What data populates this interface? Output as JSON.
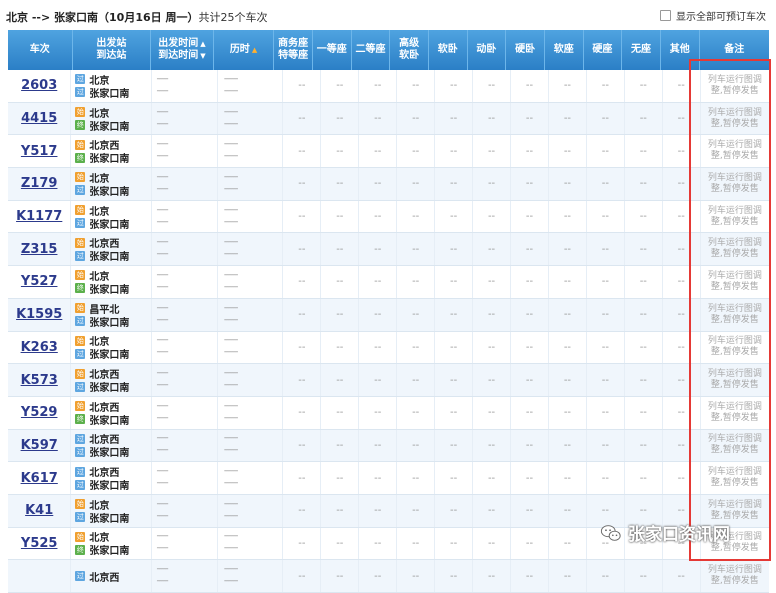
{
  "header": {
    "route": "北京 --> 张家口南（10月16日 周一）",
    "count": "共计25个车次",
    "show_all_label": "显示全部可预订车次"
  },
  "columns": {
    "train": "车次",
    "stations_1": "出发站",
    "stations_2": "到达站",
    "times_1": "出发时间",
    "times_2": "到达时间",
    "duration": "历时",
    "business_1": "商务座",
    "business_2": "特等座",
    "first": "一等座",
    "second": "二等座",
    "premium_1": "高级",
    "premium_2": "软卧",
    "soft_sleeper": "软卧",
    "moving_sleeper": "动卧",
    "hard_sleeper": "硬卧",
    "soft_seat": "软座",
    "hard_seat": "硬座",
    "no_seat": "无座",
    "other": "其他",
    "note": "备注"
  },
  "placeholders": {
    "time": "-----",
    "dur": "------",
    "seat": "--"
  },
  "badges": {
    "pass": "过",
    "start": "始",
    "end": "终"
  },
  "note_text": [
    "列车运行图调",
    "整,暂停发售"
  ],
  "trains": [
    {
      "no": "2603",
      "from": "北京",
      "from_badge": "过",
      "to": "张家口南",
      "to_badge": "过"
    },
    {
      "no": "4415",
      "from": "北京",
      "from_badge": "始",
      "to": "张家口南",
      "to_badge": "终"
    },
    {
      "no": "Y517",
      "from": "北京西",
      "from_badge": "始",
      "to": "张家口南",
      "to_badge": "终"
    },
    {
      "no": "Z179",
      "from": "北京",
      "from_badge": "始",
      "to": "张家口南",
      "to_badge": "过"
    },
    {
      "no": "K1177",
      "from": "北京",
      "from_badge": "始",
      "to": "张家口南",
      "to_badge": "过"
    },
    {
      "no": "Z315",
      "from": "北京西",
      "from_badge": "始",
      "to": "张家口南",
      "to_badge": "过"
    },
    {
      "no": "Y527",
      "from": "北京",
      "from_badge": "始",
      "to": "张家口南",
      "to_badge": "终"
    },
    {
      "no": "K1595",
      "from": "昌平北",
      "from_badge": "始",
      "to": "张家口南",
      "to_badge": "过"
    },
    {
      "no": "K263",
      "from": "北京",
      "from_badge": "始",
      "to": "张家口南",
      "to_badge": "过"
    },
    {
      "no": "K573",
      "from": "北京西",
      "from_badge": "始",
      "to": "张家口南",
      "to_badge": "过"
    },
    {
      "no": "Y529",
      "from": "北京西",
      "from_badge": "始",
      "to": "张家口南",
      "to_badge": "终"
    },
    {
      "no": "K597",
      "from": "北京西",
      "from_badge": "过",
      "to": "张家口南",
      "to_badge": "过"
    },
    {
      "no": "K617",
      "from": "北京西",
      "from_badge": "过",
      "to": "张家口南",
      "to_badge": "过"
    },
    {
      "no": "K41",
      "from": "北京",
      "from_badge": "始",
      "to": "张家口南",
      "to_badge": "过"
    },
    {
      "no": "Y525",
      "from": "北京",
      "from_badge": "始",
      "to": "张家口南",
      "to_badge": "终"
    },
    {
      "no": "",
      "from": "北京西",
      "from_badge": "过",
      "to": "",
      "to_badge": ""
    }
  ],
  "watermark": "张家口资讯网",
  "colors": {
    "header_blue": "#2b7fc6",
    "train_link": "#2c3a8c",
    "highlight_red": "#e53935"
  }
}
